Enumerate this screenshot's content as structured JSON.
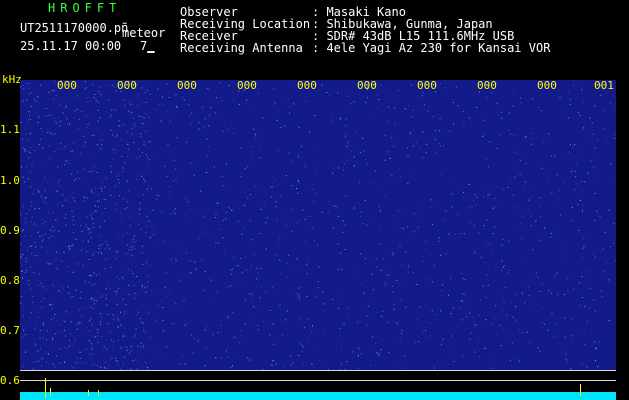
{
  "header": {
    "logo": "HROFFT",
    "filename": "UT2511170000.pñ",
    "meteor_label": "meteor",
    "datetime": "25.11.17 00:00",
    "count": "7▁",
    "info_labels": [
      "Observer",
      "Receiving Location",
      "Receiver",
      "Receiving Antenna"
    ],
    "info_values": [
      ": Masaki Kano",
      ": Shibukawa, Gunma, Japan",
      ": SDR# 43dB L15 111.6MHz USB",
      ": 4ele Yagi Az 230 for Kansai VOR"
    ]
  },
  "axes": {
    "y_unit": "kHz",
    "y_ticks": [
      "1.1",
      "1.0",
      "0.9",
      "0.8",
      "0.7",
      "0.6"
    ],
    "x_ticks": [
      "000",
      "000",
      "000",
      "000",
      "000",
      "000",
      "000",
      "000",
      "000",
      "001"
    ]
  },
  "colors": {
    "background": "#000000",
    "spectrum": "#131b8a",
    "noise_dot": "#6a8cff",
    "band": "#00e5ff",
    "label_yellow": "#ffff00",
    "logo_green": "#33ff33"
  }
}
